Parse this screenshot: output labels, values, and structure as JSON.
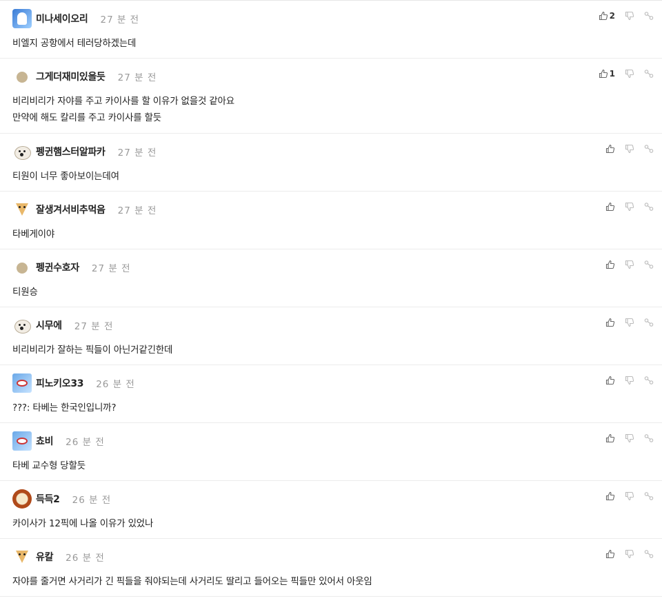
{
  "time_unit": "분 전",
  "comments": [
    {
      "author": "미나세이오리",
      "minutes": "27",
      "text": [
        "비엘지 공항에서 테러당하겠는데"
      ],
      "likes": "2",
      "avatar": "ghost-avatar"
    },
    {
      "author": "그게더재미있을듯",
      "minutes": "27",
      "text": [
        "비리비리가 자야를 주고 카이사를 할 이유가 없을것 같아요",
        "만약에 해도 칼리를 주고 카이사를 할듯"
      ],
      "likes": "1",
      "avatar": "dot-avatar"
    },
    {
      "author": "펭귄햄스터알파카",
      "minutes": "27",
      "text": [
        "티원이 너무 좋아보이는데여"
      ],
      "likes": "",
      "avatar": "dog-avatar"
    },
    {
      "author": "잘생겨서비추먹음",
      "minutes": "27",
      "text": [
        "타베게이야"
      ],
      "likes": "",
      "avatar": "fox-avatar"
    },
    {
      "author": "펭귄수호자",
      "minutes": "27",
      "text": [
        "티원승"
      ],
      "likes": "",
      "avatar": "dot-avatar"
    },
    {
      "author": "시무에",
      "minutes": "27",
      "text": [
        "비리비리가 잘하는 픽들이 아닌거같긴한데"
      ],
      "likes": "",
      "avatar": "dog-avatar"
    },
    {
      "author": "피노키오33",
      "minutes": "26",
      "text": [
        "???: 타베는 한국인입니까?"
      ],
      "likes": "",
      "avatar": "pin-avatar"
    },
    {
      "author": "쵸비",
      "minutes": "26",
      "text": [
        "타베 교수형 당할듯"
      ],
      "likes": "",
      "avatar": "pin-avatar"
    },
    {
      "author": "득득2",
      "minutes": "26",
      "text": [
        "카이사가 12픽에 나올 이유가 있었나"
      ],
      "likes": "",
      "avatar": "lion-avatar"
    },
    {
      "author": "유칼",
      "minutes": "26",
      "text": [
        "자야를 줄거면 사거리가 긴 픽들을 줘야되는데 사거리도 딸리고 들어오는 픽들만 있어서 아웃임"
      ],
      "likes": "",
      "avatar": "fox-avatar"
    }
  ],
  "icons": {
    "like": "thumbs-up-icon",
    "dislike": "thumbs-down-icon",
    "share": "share-link-icon"
  },
  "colors": {
    "text": "#222222",
    "muted": "#999999",
    "border": "#ececec"
  }
}
